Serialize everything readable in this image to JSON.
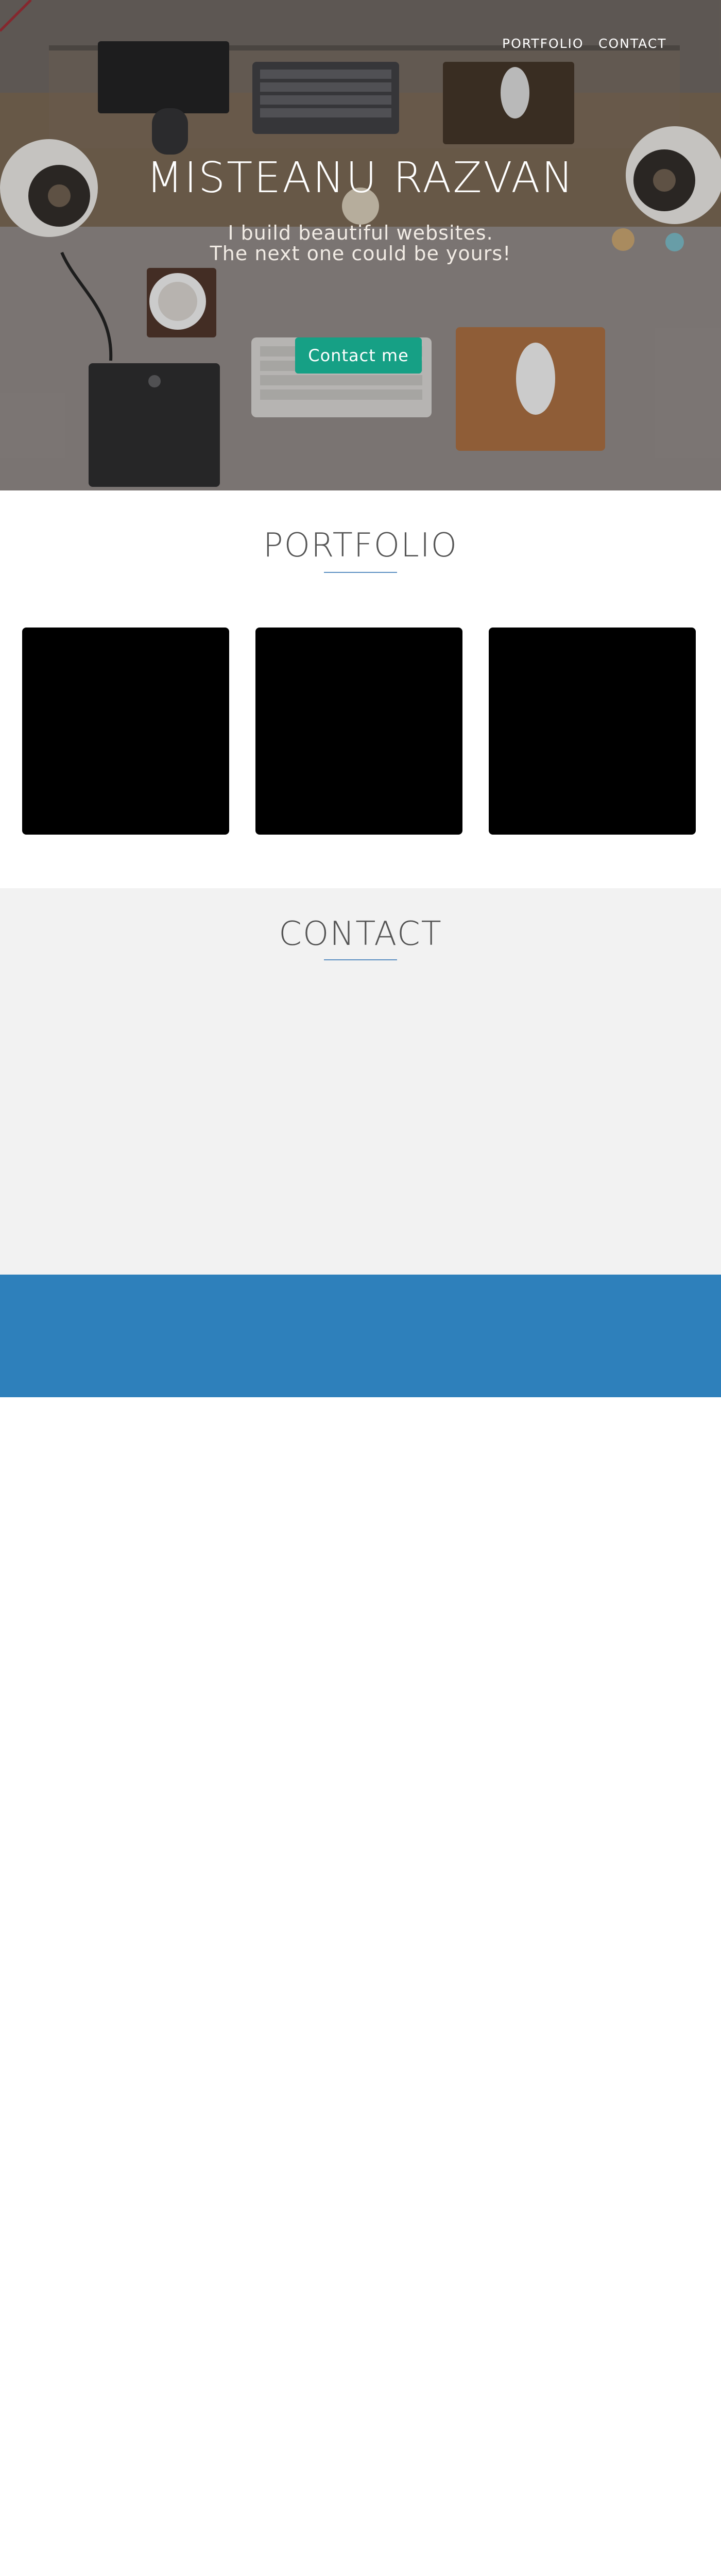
{
  "nav": {
    "portfolio_label": "PORTFOLIO",
    "contact_label": "CONTACT"
  },
  "hero": {
    "title": "MISTEANU RAZVAN",
    "subtitle_line1": "I build beautiful websites.",
    "subtitle_line2": "The next one could be yours!",
    "cta_label": "Contact me",
    "cta_color": "#16a085"
  },
  "portfolio": {
    "title": "PORTFOLIO",
    "cards": [
      {
        "label": ""
      },
      {
        "label": ""
      },
      {
        "label": ""
      }
    ]
  },
  "contact": {
    "title": "CONTACT"
  },
  "colors": {
    "accent_underline": "#5b8fc1",
    "contact_bg": "#f2f2f2",
    "footer_bg": "#2e80bb"
  }
}
